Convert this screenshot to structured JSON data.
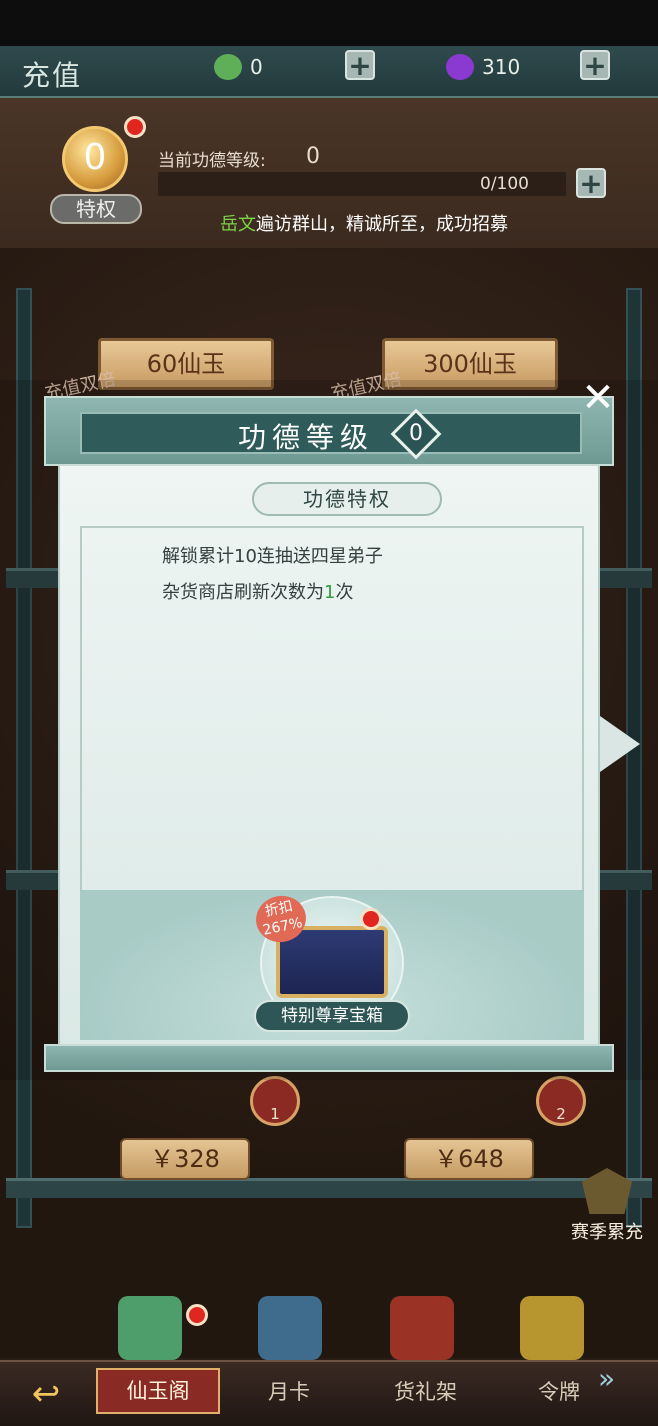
{
  "header": {
    "title": "充值",
    "currency_jade_value": "0",
    "currency_gem_value": "310"
  },
  "merit": {
    "level_badge": "0",
    "privilege_label": "特权",
    "current_label": "当前功德等级:",
    "current_value": "0",
    "progress_text": "0/100",
    "progress_fraction": 0,
    "marquee_name": "岳文",
    "marquee_text": "遍访群山，精诚所至，成功招募"
  },
  "shelf": {
    "product_left": "60仙玉",
    "product_right": "300仙玉",
    "double_tag": "充值双倍",
    "price_left": "￥328",
    "price_right": "￥648",
    "badge_left": "1",
    "badge_right": "2",
    "season_label": "赛季累充"
  },
  "dialog": {
    "title": "功德等级",
    "level": "0",
    "close_label": "✕",
    "section_title": "功德特权",
    "perks": [
      {
        "text": "解锁累计10连抽送四星弟子"
      },
      {
        "prefix": "杂货商店刷新次数为",
        "num": "1",
        "suffix": "次"
      }
    ],
    "discount_label": "折扣",
    "discount_value": "267%",
    "chest_label": "特别尊享宝箱"
  },
  "nav": {
    "back_label": "↩",
    "tabs": [
      "仙玉阁",
      "月卡",
      "货礼架",
      "令牌"
    ],
    "more_label": "»"
  },
  "colors": {
    "accent_red": "#e0261f",
    "highlight_green": "#7fd34a",
    "teal_frame": "#2f5b5a"
  }
}
